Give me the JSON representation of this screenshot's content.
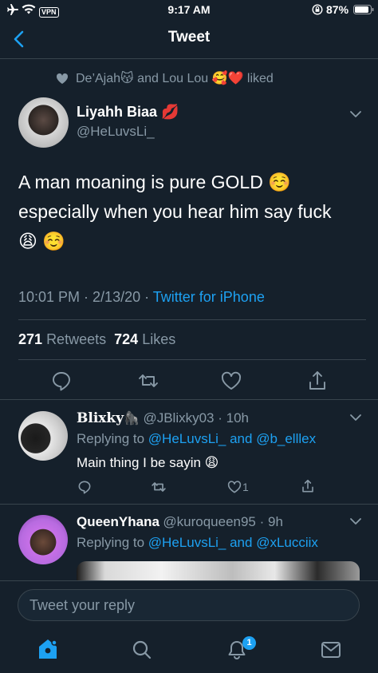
{
  "status_bar": {
    "vpn": "VPN",
    "time": "9:17 AM",
    "battery": "87%"
  },
  "header": {
    "title": "Tweet"
  },
  "liked_by": {
    "name1": "De’Ajah",
    "emoji1": "😽",
    "and_text": "and",
    "name2": "Lou Lou",
    "emoji2": "🥰❤️",
    "suffix": "liked"
  },
  "tweet": {
    "author_name": "Liyahh Biaa",
    "author_emoji": "💋",
    "handle": "@HeLuvsLi_",
    "text_line1": "A man moaning is pure GOLD ☺️",
    "text_line2": "especially when you hear him say fuck",
    "text_line3": "😩 ☺️",
    "timestamp": "10:01 PM · 2/13/20 ·",
    "source": "Twitter for iPhone",
    "retweets_count": "271",
    "retweets_label": "Retweets",
    "likes_count": "724",
    "likes_label": "Likes"
  },
  "replies": [
    {
      "name": "Blixky",
      "name_emoji": "🦍",
      "handle_time": "@JBlixky03 · 10h",
      "replying_prefix": "Replying to",
      "replying_handles": "@HeLuvsLi_ and @b_elllex",
      "text": "Main thing I be sayin 😩",
      "like_count": "1"
    },
    {
      "name": "QueenYhana",
      "handle_time": "@kuroqueen95 · 9h",
      "replying_prefix": "Replying to",
      "replying_handles": "@HeLuvsLi_ and @xLucciix"
    }
  ],
  "reply_box": {
    "placeholder": "Tweet your reply"
  },
  "tab_bar": {
    "notifications_badge": "1"
  },
  "colors": {
    "background": "#15202b",
    "accent": "#1da1f2",
    "muted": "#8899a6",
    "divider": "#38444d"
  }
}
